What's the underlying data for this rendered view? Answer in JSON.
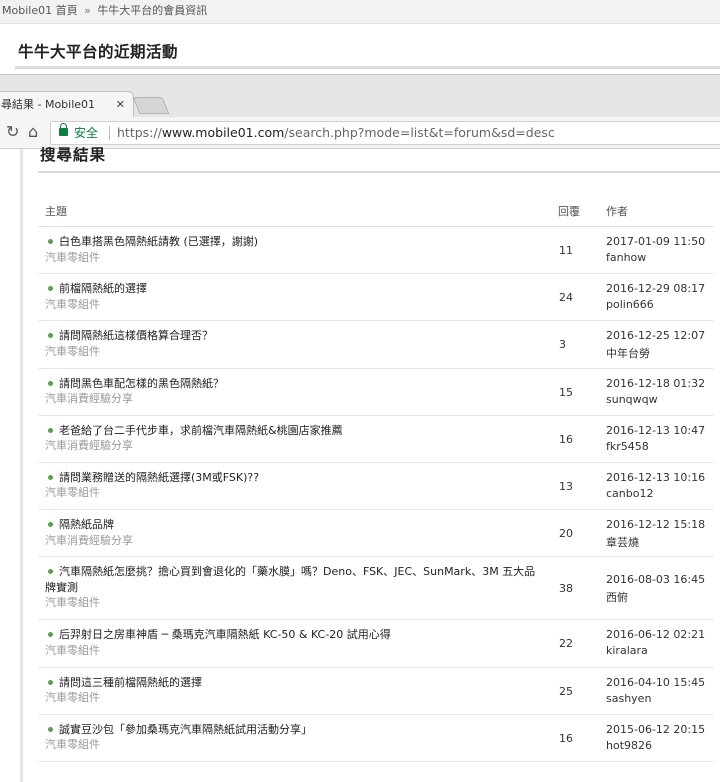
{
  "breadcrumb": {
    "home": "Mobile01 首頁",
    "separator": "»",
    "current": "牛牛大平台的會員資訊"
  },
  "page_title": "牛牛大平台的近期活動",
  "browser": {
    "tab_title": "尋結果 - Mobile01",
    "tab_close": "✕",
    "secure_label": "安全",
    "url_scheme": "https://",
    "url_host": "www.mobile01.com",
    "url_path": "/search.php?mode=list&t=forum&sd=desc"
  },
  "results": {
    "title": "搜尋結果",
    "headers": {
      "topic": "主題",
      "replies": "回覆",
      "author": "作者"
    },
    "rows": [
      {
        "title": "白色車搭黑色隔熱紙請教 (已選擇，謝謝)",
        "forum": "汽車零組件",
        "replies": "11",
        "date": "2017-01-09 11:50",
        "author": "fanhow"
      },
      {
        "title": "前檔隔熱紙的選擇",
        "forum": "汽車零組件",
        "replies": "24",
        "date": "2016-12-29 08:17",
        "author": "polin666"
      },
      {
        "title": "請問隔熱紙這樣價格算合理否？",
        "forum": "汽車零組件",
        "replies": "3",
        "date": "2016-12-25 12:07",
        "author": "中年台勞"
      },
      {
        "title": "請問黑色車配怎樣的黑色隔熱紙？",
        "forum": "汽車消費經驗分享",
        "replies": "15",
        "date": "2016-12-18 01:32",
        "author": "sunqwqw"
      },
      {
        "title": "老爸給了台二手代步車，求前檔汽車隔熱紙&桃園店家推薦",
        "forum": "汽車消費經驗分享",
        "replies": "16",
        "date": "2016-12-13 10:47",
        "author": "fkr5458"
      },
      {
        "title": "請問業務贈送的隔熱紙選擇(3M或FSK)??",
        "forum": "汽車零組件",
        "replies": "13",
        "date": "2016-12-13 10:16",
        "author": "canbo12"
      },
      {
        "title": "隔熱紙品牌",
        "forum": "汽車消費經驗分享",
        "replies": "20",
        "date": "2016-12-12 15:18",
        "author": "章芸燒"
      },
      {
        "title": "汽車隔熱紙怎麼挑？擔心買到會退化的「藥水膜」嗎？Deno、FSK、JEC、SunMark、3M 五大品牌實測",
        "forum": "汽車零組件",
        "replies": "38",
        "date": "2016-08-03 16:45",
        "author": "西俯"
      },
      {
        "title": "后羿射日之房車神盾 ─ 桑瑪克汽車隔熱紙 KC-50 & KC-20 試用心得",
        "forum": "汽車零組件",
        "replies": "22",
        "date": "2016-06-12 02:21",
        "author": "kiralara"
      },
      {
        "title": "請問這三種前檔隔熱紙的選擇",
        "forum": "汽車零組件",
        "replies": "25",
        "date": "2016-04-10 15:45",
        "author": "sashyen"
      },
      {
        "title": "誠實豆沙包「參加桑瑪克汽車隔熱紙試用活動分享」",
        "forum": "汽車零組件",
        "replies": "16",
        "date": "2015-06-12 20:15",
        "author": "hot9826"
      }
    ]
  }
}
